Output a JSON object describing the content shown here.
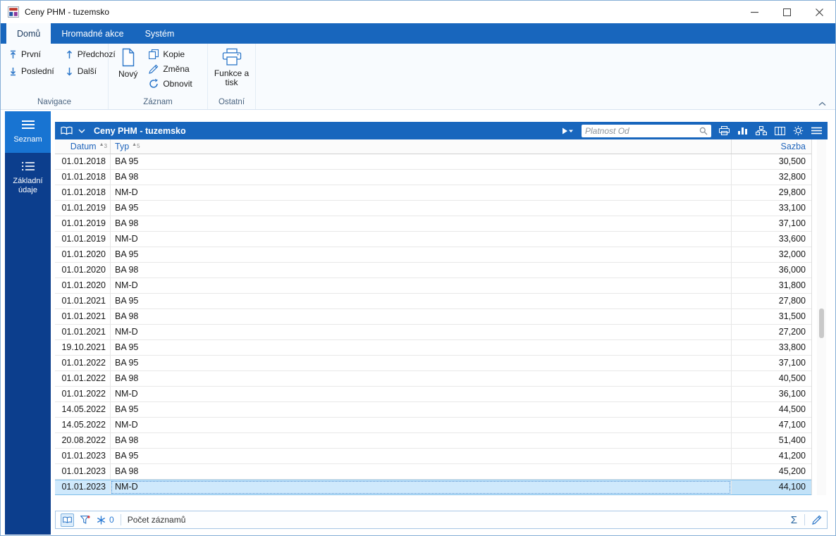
{
  "titlebar": {
    "title": "Ceny PHM - tuzemsko"
  },
  "ribbon": {
    "tabs": [
      {
        "label": "Domů"
      },
      {
        "label": "Hromadné akce"
      },
      {
        "label": "Systém"
      }
    ],
    "nav_first": "První",
    "nav_last": "Poslední",
    "nav_prev": "Předchozí",
    "nav_next": "Další",
    "rec_new": "Nový",
    "rec_copy": "Kopie",
    "rec_change": "Změna",
    "rec_refresh": "Obnovit",
    "other_functions": "Funkce a tisk",
    "group_navigation": "Navigace",
    "group_record": "Záznam",
    "group_other": "Ostatní"
  },
  "sidebar": {
    "items": [
      {
        "label": "Seznam",
        "active": true
      },
      {
        "label": "Základní údaje",
        "active": false
      }
    ]
  },
  "list": {
    "title": "Ceny PHM",
    "title_suffix": "- tuzemsko",
    "search_placeholder": "Platnost Od",
    "sort_glyph": "▲",
    "columns": {
      "datum": "Datum",
      "datum_sort_order": "3",
      "typ": "Typ",
      "typ_sort_order": "5",
      "sazba": "Sazba"
    },
    "rows": [
      {
        "datum": "01.01.2018",
        "typ": "BA 95",
        "sazba": "30,500"
      },
      {
        "datum": "01.01.2018",
        "typ": "BA 98",
        "sazba": "32,800"
      },
      {
        "datum": "01.01.2018",
        "typ": "NM-D",
        "sazba": "29,800"
      },
      {
        "datum": "01.01.2019",
        "typ": "BA 95",
        "sazba": "33,100"
      },
      {
        "datum": "01.01.2019",
        "typ": "BA 98",
        "sazba": "37,100"
      },
      {
        "datum": "01.01.2019",
        "typ": "NM-D",
        "sazba": "33,600"
      },
      {
        "datum": "01.01.2020",
        "typ": "BA 95",
        "sazba": "32,000"
      },
      {
        "datum": "01.01.2020",
        "typ": "BA 98",
        "sazba": "36,000"
      },
      {
        "datum": "01.01.2020",
        "typ": "NM-D",
        "sazba": "31,800"
      },
      {
        "datum": "01.01.2021",
        "typ": "BA 95",
        "sazba": "27,800"
      },
      {
        "datum": "01.01.2021",
        "typ": "BA 98",
        "sazba": "31,500"
      },
      {
        "datum": "01.01.2021",
        "typ": "NM-D",
        "sazba": "27,200"
      },
      {
        "datum": "19.10.2021",
        "typ": "BA 95",
        "sazba": "33,800"
      },
      {
        "datum": "01.01.2022",
        "typ": "BA 95",
        "sazba": "37,100"
      },
      {
        "datum": "01.01.2022",
        "typ": "BA 98",
        "sazba": "40,500"
      },
      {
        "datum": "01.01.2022",
        "typ": "NM-D",
        "sazba": "36,100"
      },
      {
        "datum": "14.05.2022",
        "typ": "BA 95",
        "sazba": "44,500"
      },
      {
        "datum": "14.05.2022",
        "typ": "NM-D",
        "sazba": "47,100"
      },
      {
        "datum": "20.08.2022",
        "typ": "BA 98",
        "sazba": "51,400"
      },
      {
        "datum": "01.01.2023",
        "typ": "BA 95",
        "sazba": "41,200"
      },
      {
        "datum": "01.01.2023",
        "typ": "BA 98",
        "sazba": "45,200"
      },
      {
        "datum": "01.01.2023",
        "typ": "NM-D",
        "sazba": "44,100"
      }
    ],
    "selected_row_index": 21
  },
  "statusbar": {
    "frozen_count": "0",
    "records_label": "Počet záznamů",
    "sum_symbol": "Σ"
  }
}
